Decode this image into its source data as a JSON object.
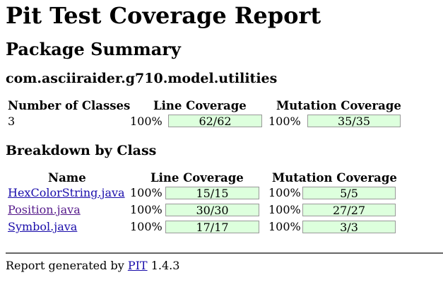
{
  "title": "Pit Test Coverage Report",
  "subtitle": "Package Summary",
  "package_name": "com.asciiraider.g710.model.utilities",
  "summary": {
    "headers": {
      "classes": "Number of Classes",
      "line": "Line Coverage",
      "mutation": "Mutation Coverage"
    },
    "classes": "3",
    "line_percent": "100%",
    "line_ratio": "62/62",
    "mutation_percent": "100%",
    "mutation_ratio": "35/35"
  },
  "breakdown": {
    "heading": "Breakdown by Class",
    "headers": {
      "name": "Name",
      "line": "Line Coverage",
      "mutation": "Mutation Coverage"
    },
    "rows": [
      {
        "name": "HexColorString.java",
        "line_percent": "100%",
        "line_ratio": "15/15",
        "mutation_percent": "100%",
        "mutation_ratio": "5/5"
      },
      {
        "name": "Position.java",
        "line_percent": "100%",
        "line_ratio": "30/30",
        "mutation_percent": "100%",
        "mutation_ratio": "27/27"
      },
      {
        "name": "Symbol.java",
        "line_percent": "100%",
        "line_ratio": "17/17",
        "mutation_percent": "100%",
        "mutation_ratio": "3/3"
      }
    ]
  },
  "footer": {
    "prefix": "Report generated by",
    "link": "PIT",
    "version": "1.4.3"
  },
  "colors": {
    "coverage_fill": "#ddffdd",
    "link": "#1a0dab",
    "visited_link": "#551a8b"
  }
}
